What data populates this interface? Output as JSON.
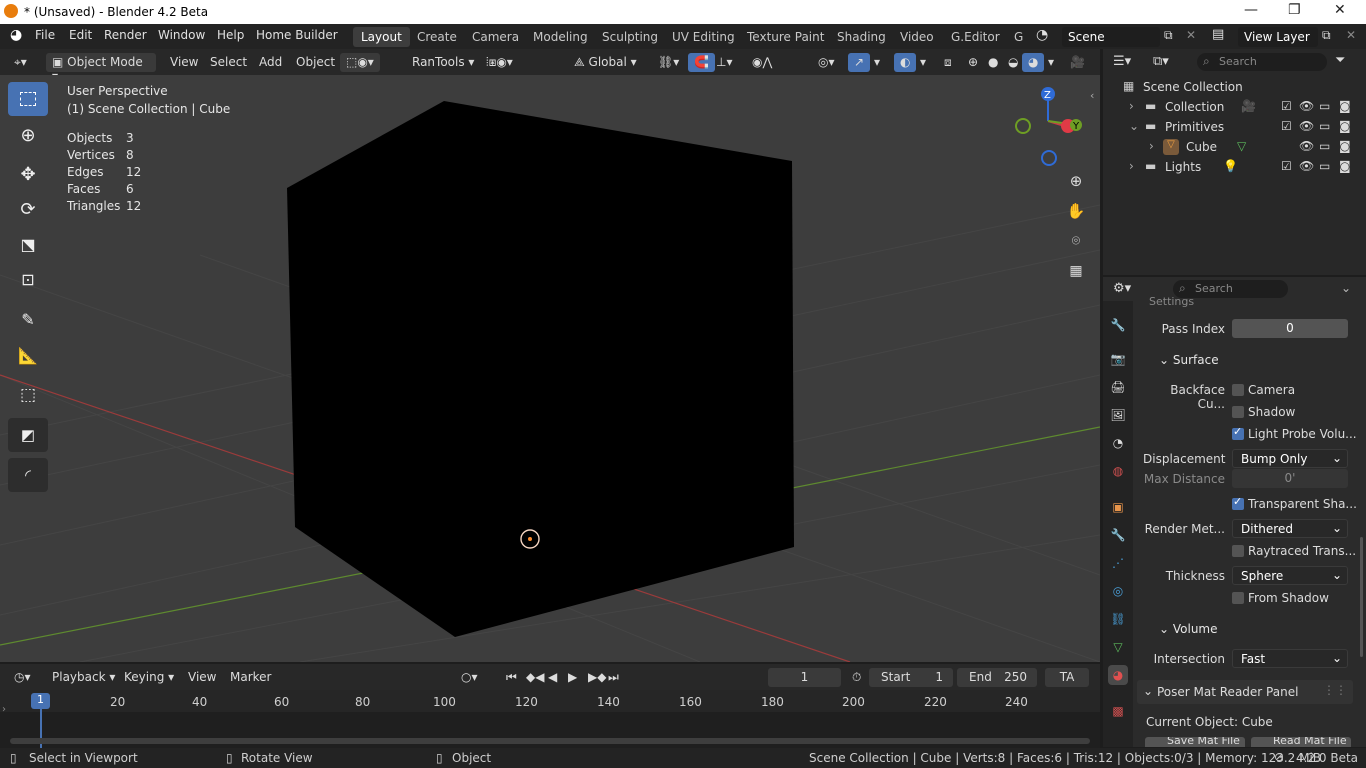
{
  "window": {
    "title": "* (Unsaved) - Blender 4.2 Beta"
  },
  "menu": [
    "File",
    "Edit",
    "Render",
    "Window",
    "Help",
    "Home Builder"
  ],
  "workspaces": {
    "active": "Layout",
    "tabs": [
      "Layout",
      "Create",
      "Camera",
      "Modeling",
      "Sculpting",
      "UV Editing",
      "Texture Paint",
      "Shading",
      "Video",
      "G.Editor",
      "G"
    ]
  },
  "scene": {
    "name": "Scene",
    "view_layer": "View Layer"
  },
  "viewport_header": {
    "mode": "Object Mode",
    "view": "View",
    "select": "Select",
    "add": "Add",
    "object": "Object",
    "rantools": "RanTools",
    "orientation": "Global"
  },
  "viewport_overlay": {
    "perspective": "User Perspective",
    "collection": "(1) Scene Collection | Cube",
    "stats": [
      {
        "label": "Objects",
        "value": "3"
      },
      {
        "label": "Vertices",
        "value": "8"
      },
      {
        "label": "Edges",
        "value": "12"
      },
      {
        "label": "Faces",
        "value": "6"
      },
      {
        "label": "Triangles",
        "value": "12"
      }
    ]
  },
  "gizmo": {
    "z": "Z",
    "y": "Y"
  },
  "outliner": {
    "search_placeholder": "Search",
    "root": "Scene Collection",
    "items": [
      {
        "label": "Collection"
      },
      {
        "label": "Primitives"
      },
      {
        "label": "Cube"
      },
      {
        "label": "Lights"
      }
    ]
  },
  "properties": {
    "search_placeholder": "Search",
    "settings_partial": "Settings",
    "pass_index_label": "Pass Index",
    "pass_index_value": "0",
    "surface": "Surface",
    "backface_label": "Backface Cu...",
    "camera": "Camera",
    "shadow": "Shadow",
    "light_probe": "Light Probe Volu...",
    "displacement_label": "Displacement",
    "displacement_value": "Bump Only",
    "max_distance_label": "Max Distance",
    "max_distance_value": "0'",
    "transparent_shadow": "Transparent Sha...",
    "render_method_label": "Render Met...",
    "render_method_value": "Dithered",
    "raytraced": "Raytraced Trans...",
    "thickness_label": "Thickness",
    "thickness_value": "Sphere",
    "from_shadow": "From Shadow",
    "volume": "Volume",
    "intersection_label": "Intersection",
    "intersection_value": "Fast",
    "poser_panel": "Poser Mat Reader Panel",
    "current_object": "Current Object: Cube",
    "save_mat": "Save Mat File",
    "read_mat": "Read Mat File",
    "checks": {
      "camera": false,
      "shadow": false,
      "light_probe": true,
      "transparent_shadow": true,
      "raytraced": false,
      "from_shadow": false
    }
  },
  "timeline": {
    "playback": "Playback",
    "keying": "Keying",
    "view": "View",
    "marker": "Marker",
    "current_frame": "1",
    "start_label": "Start",
    "start": "1",
    "end_label": "End",
    "end": "250",
    "ta": "TA",
    "ticks": [
      "1",
      "20",
      "40",
      "60",
      "80",
      "100",
      "120",
      "140",
      "160",
      "180",
      "200",
      "220",
      "240"
    ]
  },
  "status": {
    "select": "Select in Viewport",
    "rotate": "Rotate View",
    "object": "Object",
    "info": "Scene Collection | Cube | Verts:8 | Faces:6 | Tris:12 | Objects:0/3 | Memory: 123.2 MiB",
    "version": "4.2.0 Beta"
  }
}
